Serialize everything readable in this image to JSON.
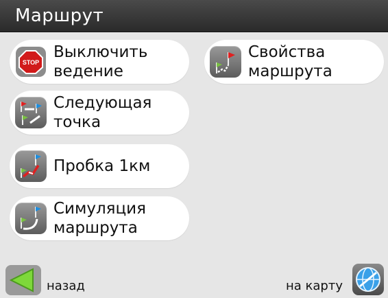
{
  "header": {
    "title": "Маршрут"
  },
  "menu": {
    "stop_guidance": {
      "line1": "Выключить",
      "line2": "ведение",
      "icon": "stop-sign-icon"
    },
    "route_properties": {
      "line1": "Свойства",
      "line2": "маршрута",
      "icon": "route-flags-icon"
    },
    "next_point": {
      "line1": "Следующая",
      "line2": "точка",
      "icon": "next-point-flags-icon"
    },
    "traffic_jam": {
      "label": "Пробка 1км",
      "icon": "traffic-jam-icon"
    },
    "simulation": {
      "line1": "Симуляция",
      "line2": "маршрута",
      "icon": "route-simulation-icon"
    }
  },
  "footer": {
    "back_label": "назад",
    "to_map_label": "на карту",
    "back_icon": "back-arrow-icon",
    "map_icon": "globe-icon"
  },
  "colors": {
    "background": "#e6e6e6",
    "titlebar": "#333333",
    "button": "#ffffff",
    "icon_tile": "#7a7a7a",
    "flag_red": "#e02020",
    "flag_blue": "#1e8fe0",
    "flag_green": "#7ac142"
  }
}
